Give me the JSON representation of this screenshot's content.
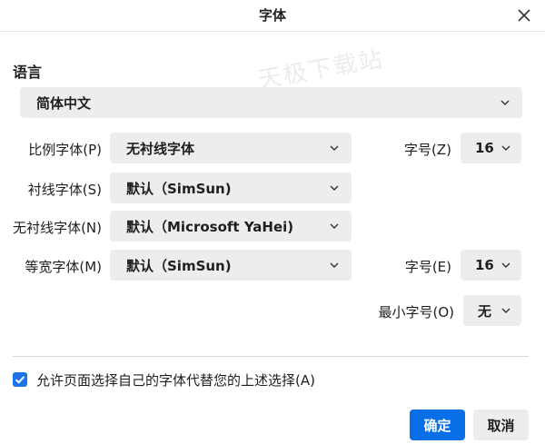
{
  "dialog": {
    "title": "字体"
  },
  "watermark": "天极下载站",
  "language": {
    "section_label": "语言",
    "selected": "简体中文"
  },
  "fonts": {
    "proportional_label": "比例字体(P)",
    "proportional_value": "无衬线字体",
    "size_label": "字号(Z)",
    "size_value": "16",
    "serif_label": "衬线字体(S)",
    "serif_value": "默认（SimSun)",
    "sans_label": "无衬线字体(N)",
    "sans_value": "默认（Microsoft YaHei)",
    "mono_label": "等宽字体(M)",
    "mono_value": "默认（SimSun)",
    "mono_size_label": "字号(E)",
    "mono_size_value": "16",
    "min_size_label": "最小字号(O)",
    "min_size_value": "无"
  },
  "allow_page_fonts": {
    "checked": true,
    "label": "允许页面选择自己的字体代替您的上述选择(A)"
  },
  "buttons": {
    "ok": "确定",
    "cancel": "取消"
  },
  "colors": {
    "accent": "#0a6fe6",
    "control_bg": "#ededed"
  }
}
